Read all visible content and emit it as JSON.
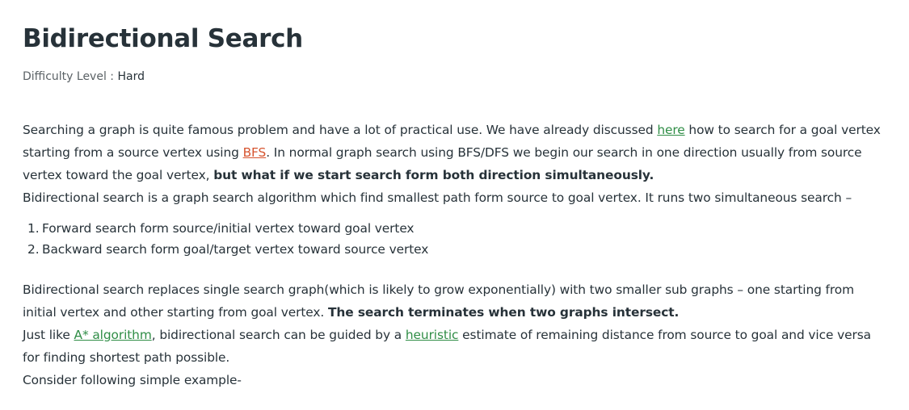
{
  "article": {
    "title": "Bidirectional Search",
    "difficulty_label": "Difficulty Level : ",
    "difficulty_value": "Hard"
  },
  "intro": {
    "s1_a": "Searching a graph is quite famous problem and have a lot of practical use. We have already discussed ",
    "link_here": "here",
    "s1_b": " how to search for a goal vertex starting from a source vertex using ",
    "link_bfs": "BFS",
    "s1_c": ". In normal graph search using BFS/DFS we begin our search in one direction usually from source vertex toward the goal vertex, ",
    "s1_bold": "but what if we start search form both direction simultaneously.",
    "s2": "Bidirectional search is a graph search algorithm which find smallest path form source to goal vertex. It runs two simultaneous search –"
  },
  "steps": [
    {
      "num": "1.",
      "text": "Forward search form source/initial vertex toward goal vertex"
    },
    {
      "num": "2.",
      "text": "Backward search form goal/target vertex toward source vertex"
    }
  ],
  "details": {
    "s3_a": "Bidirectional search replaces single search graph(which is likely to grow exponentially) with two smaller sub graphs – one starting from initial vertex and other starting from goal vertex. ",
    "s3_bold": "The search terminates when two graphs intersect.",
    "s4_a": "Just like ",
    "link_astar": "A* algorithm",
    "s4_b": ", bidirectional search can be guided by a ",
    "link_heuristic": "heuristic",
    "s4_c": " estimate of remaining distance from source to goal and vice versa for finding shortest path possible.",
    "s5": "Consider following simple example-"
  },
  "colors": {
    "text": "#273239",
    "link": "#2f8d46",
    "link_visited": "#d6542f",
    "muted": "#5b6266"
  }
}
